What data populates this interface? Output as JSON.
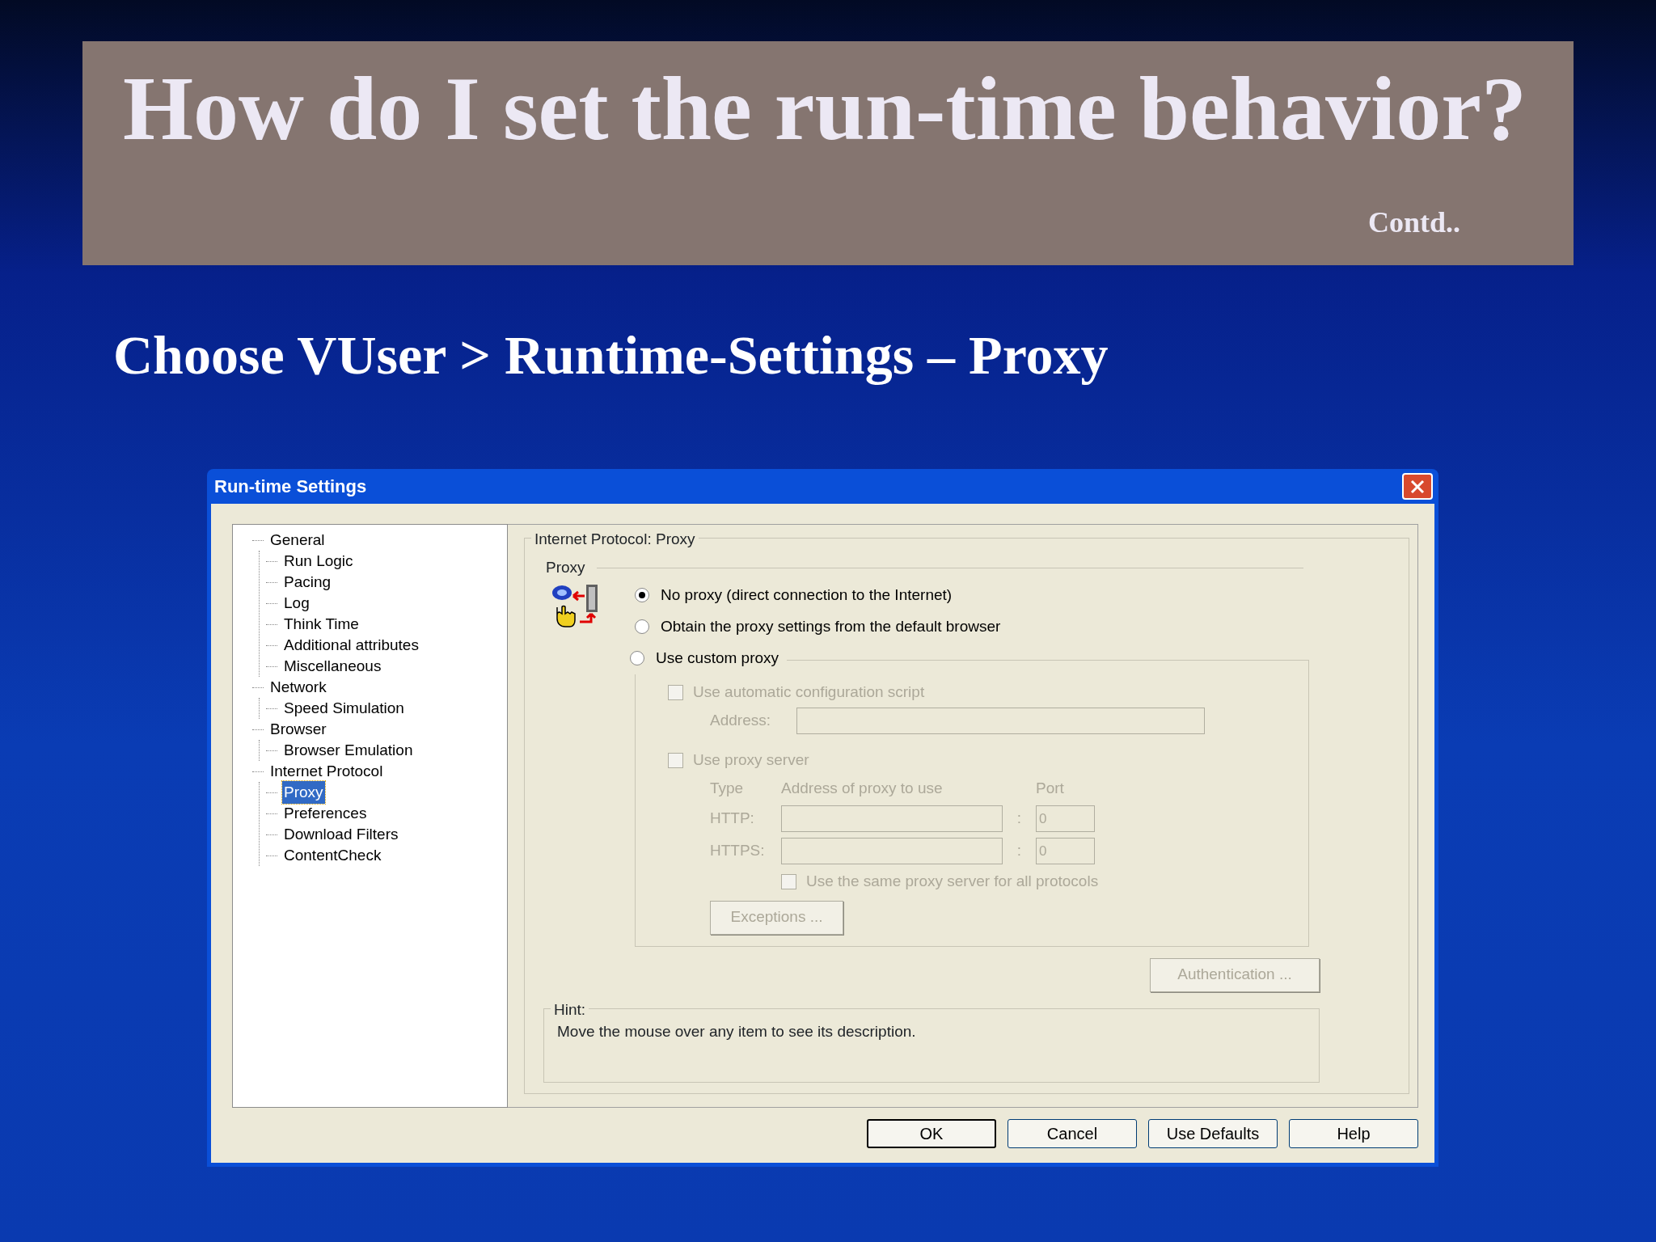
{
  "slide": {
    "title": "How do I set the run-time behavior?",
    "note": "Contd..",
    "heading": "Choose VUser > Runtime-Settings – Proxy"
  },
  "dialog": {
    "title": "Run-time Settings",
    "tree": [
      {
        "label": "General",
        "selected": false,
        "children": [
          {
            "label": "Run Logic",
            "selected": false
          },
          {
            "label": "Pacing",
            "selected": false
          },
          {
            "label": "Log",
            "selected": false
          },
          {
            "label": "Think Time",
            "selected": false
          },
          {
            "label": "Additional attributes",
            "selected": false
          },
          {
            "label": "Miscellaneous",
            "selected": false
          }
        ]
      },
      {
        "label": "Network",
        "selected": false,
        "children": [
          {
            "label": "Speed Simulation",
            "selected": false
          }
        ]
      },
      {
        "label": "Browser",
        "selected": false,
        "children": [
          {
            "label": "Browser Emulation",
            "selected": false
          }
        ]
      },
      {
        "label": "Internet Protocol",
        "selected": false,
        "children": [
          {
            "label": "Proxy",
            "selected": true
          },
          {
            "label": "Preferences",
            "selected": false
          },
          {
            "label": "Download Filters",
            "selected": false
          },
          {
            "label": "ContentCheck",
            "selected": false
          }
        ]
      }
    ],
    "panel_title": "Internet Protocol: Proxy",
    "section": "Proxy",
    "radios": [
      {
        "label": "No proxy (direct connection to the Internet)",
        "selected": true
      },
      {
        "label": "Obtain the proxy settings from the default browser",
        "selected": false
      },
      {
        "label": "Use custom proxy",
        "selected": false
      }
    ],
    "custom": {
      "disabled": true,
      "auto_script": {
        "label": "Use automatic configuration script",
        "checked": false
      },
      "address_label": "Address:",
      "proxy_server": {
        "label": "Use proxy server",
        "checked": false
      },
      "headers": [
        "Type",
        "Address of proxy to use",
        "Port"
      ],
      "protocols": [
        {
          "label": "HTTP:",
          "separator": ":",
          "port": "0"
        },
        {
          "label": "HTTPS:",
          "separator": ":",
          "port": "0"
        }
      ],
      "same_proxy": {
        "label": "Use the same proxy server for all protocols",
        "checked": false
      },
      "exceptions": "Exceptions ..."
    },
    "authentication": {
      "label": "Authentication ...",
      "disabled": true
    },
    "hint_title": "Hint:",
    "hint": "Move the mouse over any item to see its description.",
    "buttons": [
      {
        "label": "OK",
        "default": true
      },
      {
        "label": "Cancel",
        "default": false
      },
      {
        "label": "Use Defaults",
        "default": false
      },
      {
        "label": "Help",
        "default": false
      }
    ]
  }
}
